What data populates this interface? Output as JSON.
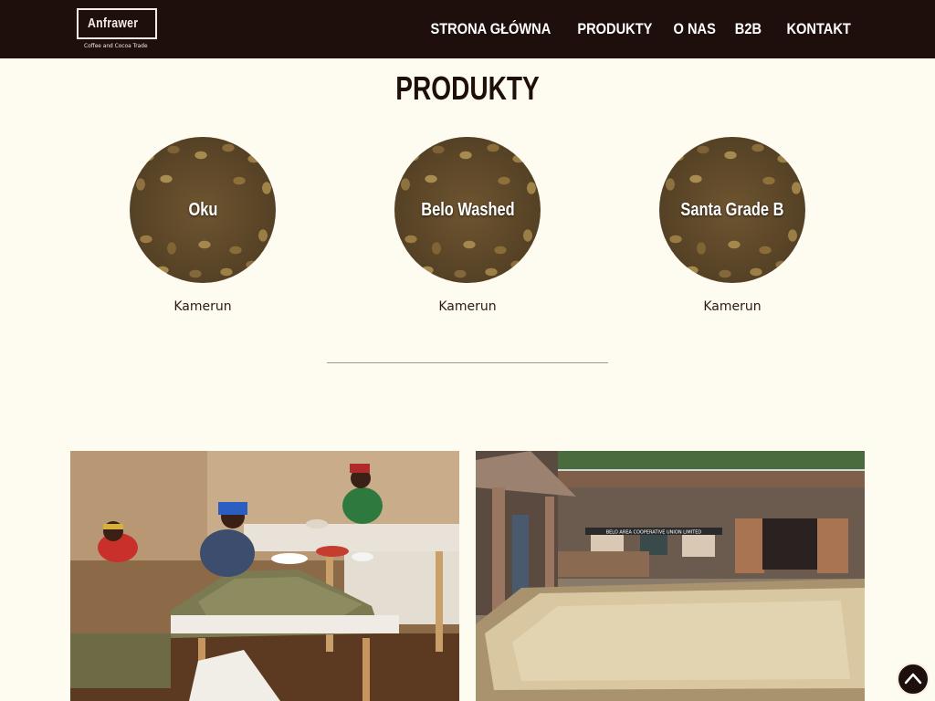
{
  "header": {
    "logo_name": "Anfrawer",
    "logo_tagline": "Coffee and Cocoa Trade",
    "nav": [
      {
        "label": "STRONA GŁÓWNA"
      },
      {
        "label": "PRODUKTY"
      },
      {
        "label": "O NAS"
      },
      {
        "label": "B2B"
      },
      {
        "label": "KONTAKT"
      }
    ]
  },
  "main": {
    "title": "PRODUKTY",
    "products": [
      {
        "name": "Oku",
        "origin": "Kamerun"
      },
      {
        "name": "Belo Washed",
        "origin": "Kamerun"
      },
      {
        "name": "Santa Grade B",
        "origin": "Kamerun"
      }
    ],
    "banner_text": "BELO AREA COOPERATIVE UNION LIMITED"
  },
  "colors": {
    "header_bg": "#1f0f0c",
    "page_bg": "#fefcf0",
    "text": "#2a1a12"
  },
  "icons": {
    "scroll_top": "chevron-up-icon"
  }
}
